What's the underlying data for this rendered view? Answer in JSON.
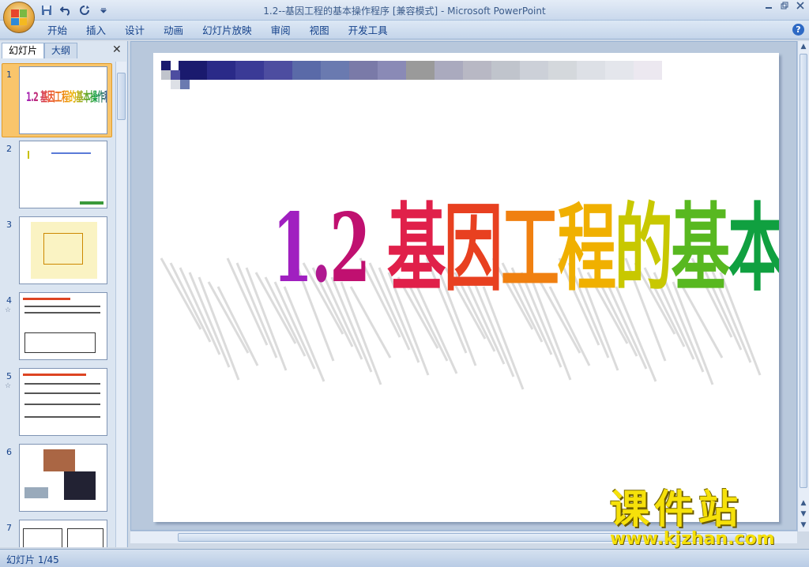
{
  "window": {
    "title": "1.2--基因工程的基本操作程序 [兼容模式] - Microsoft PowerPoint"
  },
  "quick_access": {
    "icons": [
      "save-icon",
      "undo-icon",
      "redo-icon",
      "customize-icon"
    ]
  },
  "ribbon": {
    "tabs": [
      {
        "label": "开始"
      },
      {
        "label": "插入"
      },
      {
        "label": "设计"
      },
      {
        "label": "动画"
      },
      {
        "label": "幻灯片放映"
      },
      {
        "label": "审阅"
      },
      {
        "label": "视图"
      },
      {
        "label": "开发工具"
      }
    ],
    "help_label": "?"
  },
  "left_panel": {
    "tabs": [
      {
        "label": "幻灯片",
        "active": true
      },
      {
        "label": "大纲",
        "active": false
      }
    ],
    "close_label": "✕",
    "slides": [
      {
        "number": "1",
        "selected": true,
        "has_star": false
      },
      {
        "number": "2",
        "selected": false,
        "has_star": false
      },
      {
        "number": "3",
        "selected": false,
        "has_star": false
      },
      {
        "number": "4",
        "selected": false,
        "has_star": true
      },
      {
        "number": "5",
        "selected": false,
        "has_star": true
      },
      {
        "number": "6",
        "selected": false,
        "has_star": false
      },
      {
        "number": "7",
        "selected": false,
        "has_star": false
      }
    ]
  },
  "slide": {
    "title_chars": [
      "1",
      ".",
      "2",
      " ",
      "基",
      "因",
      "工",
      "程",
      "的",
      "基",
      "本",
      "操",
      "作",
      "程",
      "序"
    ],
    "title_colors": [
      "#a020c0",
      "#b01890",
      "#c01070",
      "#ffffff",
      "#e0204a",
      "#e84020",
      "#f08010",
      "#f0b000",
      "#c8c800",
      "#58b820",
      "#10a040",
      "#108870",
      "#1060b0",
      "#3040c0",
      "#8020d0"
    ]
  },
  "watermark": {
    "logo": "课件站",
    "url": "www.kjzhan.com"
  },
  "status": {
    "text": "幻灯片 1/45"
  }
}
